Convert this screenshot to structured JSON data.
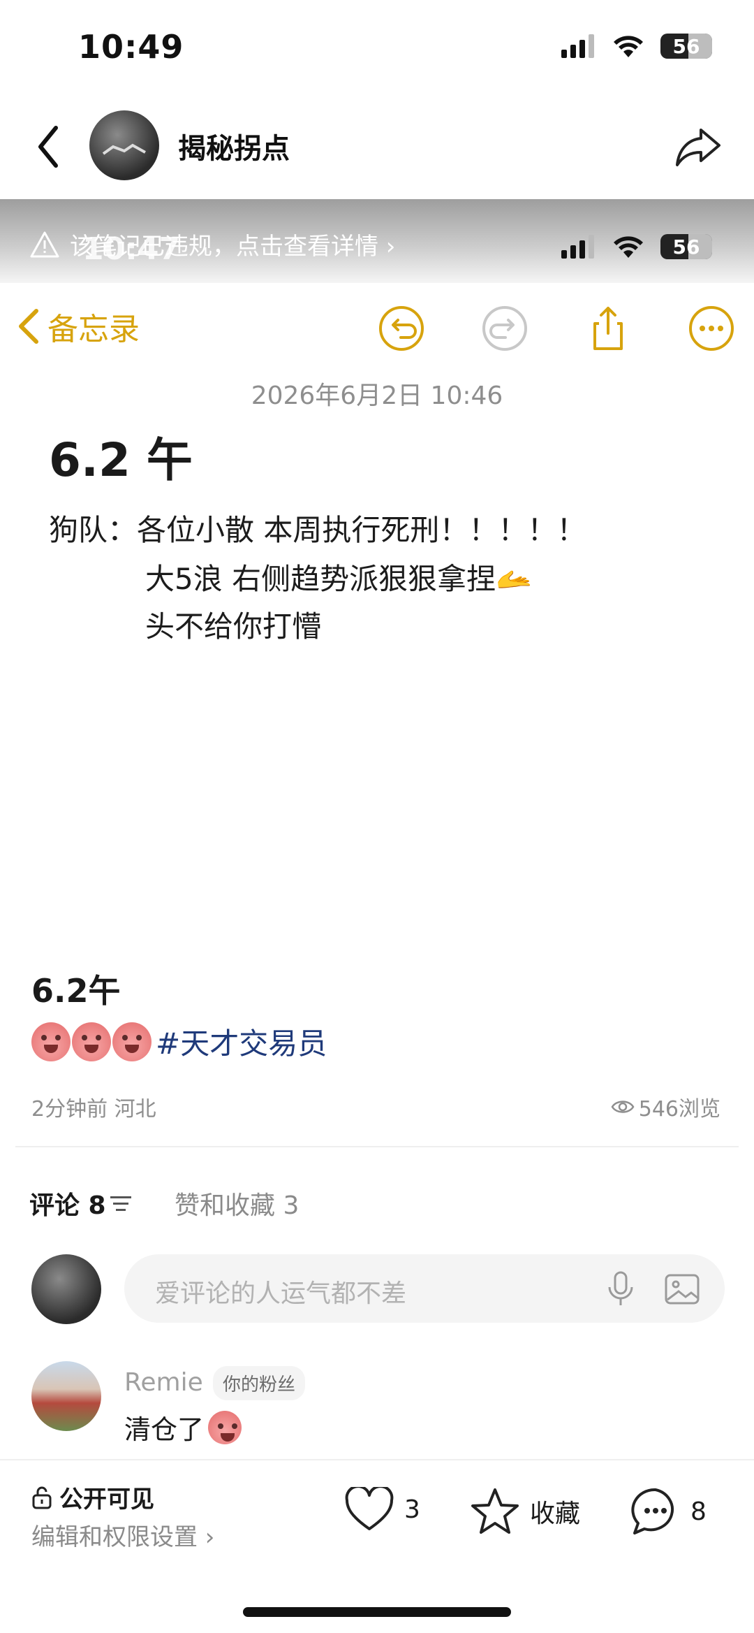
{
  "status_bar": {
    "time": "10:49",
    "battery": "56"
  },
  "header": {
    "title": "揭秘拐点"
  },
  "screenshot": {
    "violation_text": "该笔记已违规，点击查看详情 ›",
    "time": "10:47",
    "battery": "56",
    "memo_back_label": "备忘录",
    "memo_date": "2026年6月2日 10:46",
    "memo_title": "6.2 午",
    "lines": [
      "狗队：各位小散 本周执行死刑！！！！！",
      "大5浪 右侧趋势派狠狠拿捏🫴",
      "头不给你打懵"
    ]
  },
  "post": {
    "title": "6.2午",
    "hashtag": "#天才交易员",
    "time_location": "2分钟前 河北",
    "views": "546浏览"
  },
  "tabs": {
    "comments": "评论 8",
    "likes": "赞和收藏 3"
  },
  "comment_input": {
    "placeholder": "爱评论的人运气都不差"
  },
  "comments": [
    {
      "name": "Remie",
      "badge": "你的粉丝",
      "text": "清仓了"
    }
  ],
  "bottom": {
    "visibility": "公开可见",
    "edit": "编辑和权限设置 ›",
    "likes": "3",
    "favorite": "收藏",
    "comments": "8"
  },
  "colors": {
    "accent_yellow": "#d7a30d",
    "hashtag_blue": "#1f3a7a",
    "muted": "#8e8e8e"
  }
}
